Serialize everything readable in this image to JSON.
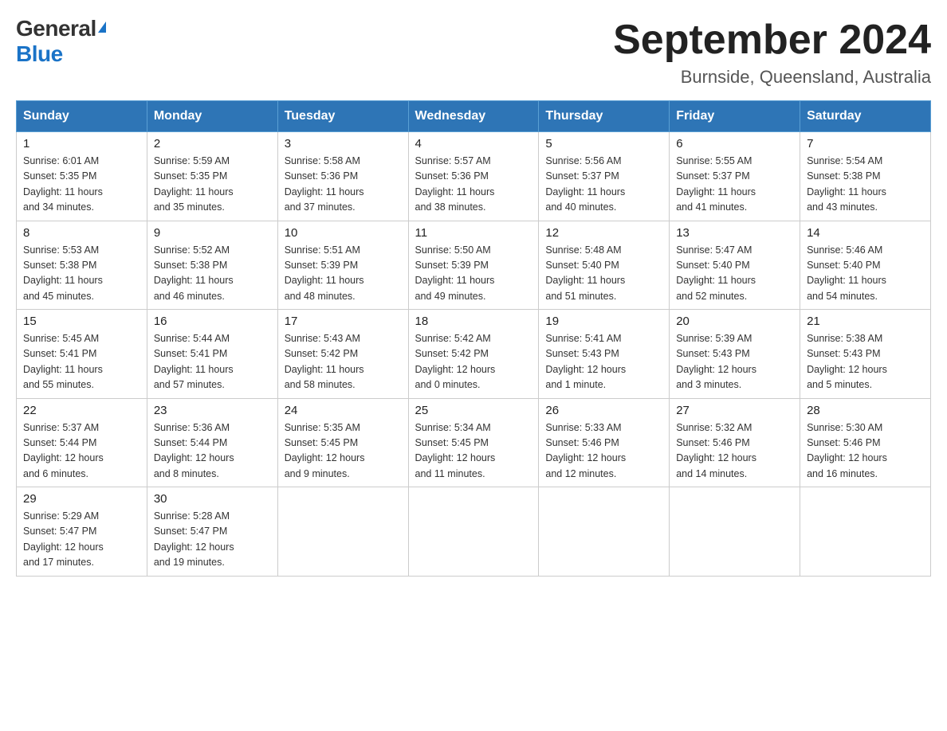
{
  "logo": {
    "general": "General",
    "blue": "Blue"
  },
  "title": "September 2024",
  "location": "Burnside, Queensland, Australia",
  "days_of_week": [
    "Sunday",
    "Monday",
    "Tuesday",
    "Wednesday",
    "Thursday",
    "Friday",
    "Saturday"
  ],
  "weeks": [
    [
      {
        "day": "1",
        "sunrise": "6:01 AM",
        "sunset": "5:35 PM",
        "daylight": "11 hours and 34 minutes."
      },
      {
        "day": "2",
        "sunrise": "5:59 AM",
        "sunset": "5:35 PM",
        "daylight": "11 hours and 35 minutes."
      },
      {
        "day": "3",
        "sunrise": "5:58 AM",
        "sunset": "5:36 PM",
        "daylight": "11 hours and 37 minutes."
      },
      {
        "day": "4",
        "sunrise": "5:57 AM",
        "sunset": "5:36 PM",
        "daylight": "11 hours and 38 minutes."
      },
      {
        "day": "5",
        "sunrise": "5:56 AM",
        "sunset": "5:37 PM",
        "daylight": "11 hours and 40 minutes."
      },
      {
        "day": "6",
        "sunrise": "5:55 AM",
        "sunset": "5:37 PM",
        "daylight": "11 hours and 41 minutes."
      },
      {
        "day": "7",
        "sunrise": "5:54 AM",
        "sunset": "5:38 PM",
        "daylight": "11 hours and 43 minutes."
      }
    ],
    [
      {
        "day": "8",
        "sunrise": "5:53 AM",
        "sunset": "5:38 PM",
        "daylight": "11 hours and 45 minutes."
      },
      {
        "day": "9",
        "sunrise": "5:52 AM",
        "sunset": "5:38 PM",
        "daylight": "11 hours and 46 minutes."
      },
      {
        "day": "10",
        "sunrise": "5:51 AM",
        "sunset": "5:39 PM",
        "daylight": "11 hours and 48 minutes."
      },
      {
        "day": "11",
        "sunrise": "5:50 AM",
        "sunset": "5:39 PM",
        "daylight": "11 hours and 49 minutes."
      },
      {
        "day": "12",
        "sunrise": "5:48 AM",
        "sunset": "5:40 PM",
        "daylight": "11 hours and 51 minutes."
      },
      {
        "day": "13",
        "sunrise": "5:47 AM",
        "sunset": "5:40 PM",
        "daylight": "11 hours and 52 minutes."
      },
      {
        "day": "14",
        "sunrise": "5:46 AM",
        "sunset": "5:40 PM",
        "daylight": "11 hours and 54 minutes."
      }
    ],
    [
      {
        "day": "15",
        "sunrise": "5:45 AM",
        "sunset": "5:41 PM",
        "daylight": "11 hours and 55 minutes."
      },
      {
        "day": "16",
        "sunrise": "5:44 AM",
        "sunset": "5:41 PM",
        "daylight": "11 hours and 57 minutes."
      },
      {
        "day": "17",
        "sunrise": "5:43 AM",
        "sunset": "5:42 PM",
        "daylight": "11 hours and 58 minutes."
      },
      {
        "day": "18",
        "sunrise": "5:42 AM",
        "sunset": "5:42 PM",
        "daylight": "12 hours and 0 minutes."
      },
      {
        "day": "19",
        "sunrise": "5:41 AM",
        "sunset": "5:43 PM",
        "daylight": "12 hours and 1 minute."
      },
      {
        "day": "20",
        "sunrise": "5:39 AM",
        "sunset": "5:43 PM",
        "daylight": "12 hours and 3 minutes."
      },
      {
        "day": "21",
        "sunrise": "5:38 AM",
        "sunset": "5:43 PM",
        "daylight": "12 hours and 5 minutes."
      }
    ],
    [
      {
        "day": "22",
        "sunrise": "5:37 AM",
        "sunset": "5:44 PM",
        "daylight": "12 hours and 6 minutes."
      },
      {
        "day": "23",
        "sunrise": "5:36 AM",
        "sunset": "5:44 PM",
        "daylight": "12 hours and 8 minutes."
      },
      {
        "day": "24",
        "sunrise": "5:35 AM",
        "sunset": "5:45 PM",
        "daylight": "12 hours and 9 minutes."
      },
      {
        "day": "25",
        "sunrise": "5:34 AM",
        "sunset": "5:45 PM",
        "daylight": "12 hours and 11 minutes."
      },
      {
        "day": "26",
        "sunrise": "5:33 AM",
        "sunset": "5:46 PM",
        "daylight": "12 hours and 12 minutes."
      },
      {
        "day": "27",
        "sunrise": "5:32 AM",
        "sunset": "5:46 PM",
        "daylight": "12 hours and 14 minutes."
      },
      {
        "day": "28",
        "sunrise": "5:30 AM",
        "sunset": "5:46 PM",
        "daylight": "12 hours and 16 minutes."
      }
    ],
    [
      {
        "day": "29",
        "sunrise": "5:29 AM",
        "sunset": "5:47 PM",
        "daylight": "12 hours and 17 minutes."
      },
      {
        "day": "30",
        "sunrise": "5:28 AM",
        "sunset": "5:47 PM",
        "daylight": "12 hours and 19 minutes."
      },
      null,
      null,
      null,
      null,
      null
    ]
  ],
  "labels": {
    "sunrise": "Sunrise:",
    "sunset": "Sunset:",
    "daylight": "Daylight:"
  }
}
